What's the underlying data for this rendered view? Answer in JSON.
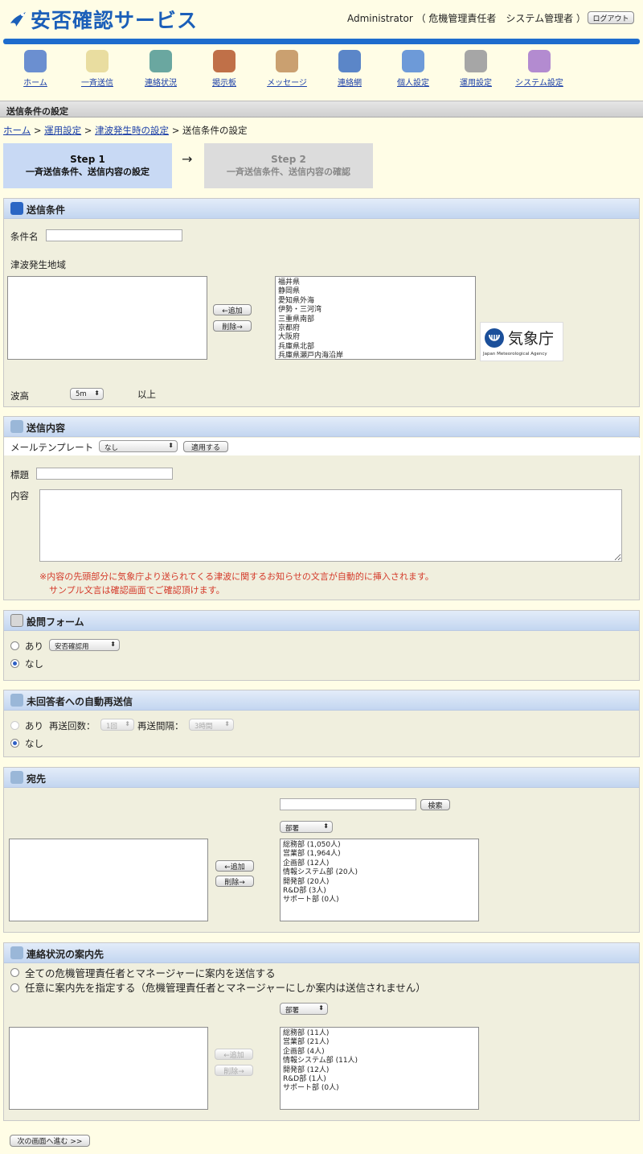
{
  "header": {
    "logo_text": "安否確認サービス",
    "user_label": "Administrator （ 危機管理責任者　システム管理者 ）",
    "logout_label": "ログアウト",
    "accent_color": "#1e6ccd"
  },
  "nav": [
    {
      "label": "ホーム",
      "icon": "house-icon",
      "color": "#6b8fd0"
    },
    {
      "label": "一斉送信",
      "icon": "envelope-icon",
      "color": "#e9dda0"
    },
    {
      "label": "連絡状況",
      "icon": "report-icon",
      "color": "#6aa7a0"
    },
    {
      "label": "掲示板",
      "icon": "board-icon",
      "color": "#c07048"
    },
    {
      "label": "メッセージ",
      "icon": "message-icon",
      "color": "#caa070"
    },
    {
      "label": "連絡網",
      "icon": "book-icon",
      "color": "#5b86c8"
    },
    {
      "label": "個人設定",
      "icon": "users-icon",
      "color": "#6d9ad8"
    },
    {
      "label": "運用設定",
      "icon": "gears-icon",
      "color": "#a6a6a6"
    },
    {
      "label": "システム設定",
      "icon": "system-gears-icon",
      "color": "#b38bd0"
    }
  ],
  "page_title": "送信条件の設定",
  "breadcrumb": {
    "items": [
      "ホーム",
      "運用設定",
      "津波発生時の設定"
    ],
    "current": "送信条件の設定",
    "separator": ">"
  },
  "steps": {
    "step1_num": "Step 1",
    "step1_label": "一斉送信条件、送信内容の設定",
    "arrow": "→",
    "step2_num": "Step 2",
    "step2_label": "一斉送信条件、送信内容の確認"
  },
  "conditions": {
    "title": "送信条件",
    "name_label": "条件名",
    "name_value": "",
    "region_label": "津波発生地域",
    "add_button": "←追加",
    "remove_button": "削除→",
    "regions": [
      "福井県",
      "静岡県",
      "愛知県外海",
      "伊勢・三河湾",
      "三重県南部",
      "京都府",
      "大阪府",
      "兵庫県北部",
      "兵庫県瀬戸内海沿岸"
    ],
    "jma_name": "気象庁",
    "jma_en": "Japan Meteorological Agency",
    "wave_label": "波高",
    "wave_value": "5m",
    "wave_suffix": "以上"
  },
  "content": {
    "title": "送信内容",
    "template_label": "メールテンプレート",
    "template_value": "なし",
    "apply_button": "適用する",
    "subject_label": "標題",
    "subject_value": "",
    "body_label": "内容",
    "body_value": "",
    "note_line1": "※内容の先頭部分に気象庁より送られてくる津波に関するお知らせの文言が自動的に挿入されます。",
    "note_line2": "サンプル文言は確認画面でご確認頂けます。",
    "note_color": "#d43a2a"
  },
  "survey": {
    "title": "設問フォーム",
    "yes_label": "あり",
    "yes_select": "安否確認用",
    "no_label": "なし"
  },
  "resend": {
    "title": "未回答者への自動再送信",
    "yes_label": "あり",
    "count_label": "再送回数：",
    "count_value": "1回",
    "interval_label": "再送間隔：",
    "interval_value": "3時間",
    "no_label": "なし"
  },
  "recipients": {
    "title": "宛先",
    "search_value": "",
    "search_button": "検索",
    "group_select": "部署",
    "add_button": "←追加",
    "remove_button": "削除→",
    "departments": [
      "総務部 (1,050人)",
      "営業部 (1,964人)",
      "企画部 (12人)",
      "情報システム部 (20人)",
      "開発部 (20人)",
      "R&D部 (3人)",
      "サポート部 (0人)"
    ]
  },
  "notify": {
    "title": "連絡状況の案内先",
    "option_all": "全ての危機管理責任者とマネージャーに案内を送信する",
    "option_custom": "任意に案内先を指定する（危機管理責任者とマネージャーにしか案内は送信されません）",
    "group_select": "部署",
    "add_button": "←追加",
    "remove_button": "削除→",
    "departments": [
      "総務部 (11人)",
      "営業部 (21人)",
      "企画部 (4人)",
      "情報システム部 (11人)",
      "開発部 (12人)",
      "R&D部 (1人)",
      "サポート部 (0人)"
    ]
  },
  "next_button": "次の画面へ進む >>"
}
